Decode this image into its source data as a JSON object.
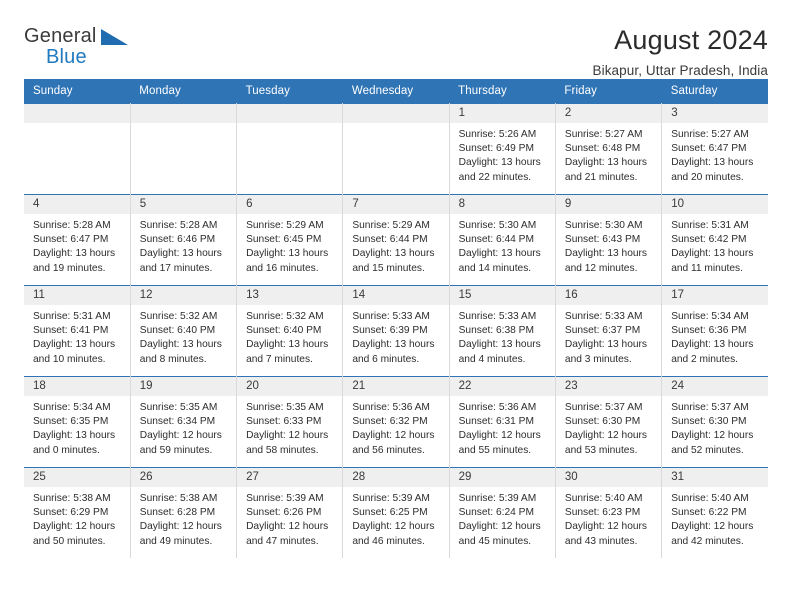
{
  "logo": {
    "word_top": "General",
    "word_bottom": "Blue",
    "accent_color": "#1f6cb0"
  },
  "header": {
    "title": "August 2024",
    "subtitle": "Bikapur, Uttar Pradesh, India"
  },
  "theme": {
    "header_blue": "#2f74b5",
    "daynum_band": "#efefef",
    "grid_line": "#d9d9d9"
  },
  "weekday_headers": [
    "Sunday",
    "Monday",
    "Tuesday",
    "Wednesday",
    "Thursday",
    "Friday",
    "Saturday"
  ],
  "weeks": [
    [
      {
        "day": "",
        "sunrise": "",
        "sunset": "",
        "daylight": "",
        "empty": true
      },
      {
        "day": "",
        "sunrise": "",
        "sunset": "",
        "daylight": "",
        "empty": true
      },
      {
        "day": "",
        "sunrise": "",
        "sunset": "",
        "daylight": "",
        "empty": true
      },
      {
        "day": "",
        "sunrise": "",
        "sunset": "",
        "daylight": "",
        "empty": true
      },
      {
        "day": "1",
        "sunrise": "Sunrise: 5:26 AM",
        "sunset": "Sunset: 6:49 PM",
        "daylight": "Daylight: 13 hours and 22 minutes."
      },
      {
        "day": "2",
        "sunrise": "Sunrise: 5:27 AM",
        "sunset": "Sunset: 6:48 PM",
        "daylight": "Daylight: 13 hours and 21 minutes."
      },
      {
        "day": "3",
        "sunrise": "Sunrise: 5:27 AM",
        "sunset": "Sunset: 6:47 PM",
        "daylight": "Daylight: 13 hours and 20 minutes."
      }
    ],
    [
      {
        "day": "4",
        "sunrise": "Sunrise: 5:28 AM",
        "sunset": "Sunset: 6:47 PM",
        "daylight": "Daylight: 13 hours and 19 minutes."
      },
      {
        "day": "5",
        "sunrise": "Sunrise: 5:28 AM",
        "sunset": "Sunset: 6:46 PM",
        "daylight": "Daylight: 13 hours and 17 minutes."
      },
      {
        "day": "6",
        "sunrise": "Sunrise: 5:29 AM",
        "sunset": "Sunset: 6:45 PM",
        "daylight": "Daylight: 13 hours and 16 minutes."
      },
      {
        "day": "7",
        "sunrise": "Sunrise: 5:29 AM",
        "sunset": "Sunset: 6:44 PM",
        "daylight": "Daylight: 13 hours and 15 minutes."
      },
      {
        "day": "8",
        "sunrise": "Sunrise: 5:30 AM",
        "sunset": "Sunset: 6:44 PM",
        "daylight": "Daylight: 13 hours and 14 minutes."
      },
      {
        "day": "9",
        "sunrise": "Sunrise: 5:30 AM",
        "sunset": "Sunset: 6:43 PM",
        "daylight": "Daylight: 13 hours and 12 minutes."
      },
      {
        "day": "10",
        "sunrise": "Sunrise: 5:31 AM",
        "sunset": "Sunset: 6:42 PM",
        "daylight": "Daylight: 13 hours and 11 minutes."
      }
    ],
    [
      {
        "day": "11",
        "sunrise": "Sunrise: 5:31 AM",
        "sunset": "Sunset: 6:41 PM",
        "daylight": "Daylight: 13 hours and 10 minutes."
      },
      {
        "day": "12",
        "sunrise": "Sunrise: 5:32 AM",
        "sunset": "Sunset: 6:40 PM",
        "daylight": "Daylight: 13 hours and 8 minutes."
      },
      {
        "day": "13",
        "sunrise": "Sunrise: 5:32 AM",
        "sunset": "Sunset: 6:40 PM",
        "daylight": "Daylight: 13 hours and 7 minutes."
      },
      {
        "day": "14",
        "sunrise": "Sunrise: 5:33 AM",
        "sunset": "Sunset: 6:39 PM",
        "daylight": "Daylight: 13 hours and 6 minutes."
      },
      {
        "day": "15",
        "sunrise": "Sunrise: 5:33 AM",
        "sunset": "Sunset: 6:38 PM",
        "daylight": "Daylight: 13 hours and 4 minutes."
      },
      {
        "day": "16",
        "sunrise": "Sunrise: 5:33 AM",
        "sunset": "Sunset: 6:37 PM",
        "daylight": "Daylight: 13 hours and 3 minutes."
      },
      {
        "day": "17",
        "sunrise": "Sunrise: 5:34 AM",
        "sunset": "Sunset: 6:36 PM",
        "daylight": "Daylight: 13 hours and 2 minutes."
      }
    ],
    [
      {
        "day": "18",
        "sunrise": "Sunrise: 5:34 AM",
        "sunset": "Sunset: 6:35 PM",
        "daylight": "Daylight: 13 hours and 0 minutes."
      },
      {
        "day": "19",
        "sunrise": "Sunrise: 5:35 AM",
        "sunset": "Sunset: 6:34 PM",
        "daylight": "Daylight: 12 hours and 59 minutes."
      },
      {
        "day": "20",
        "sunrise": "Sunrise: 5:35 AM",
        "sunset": "Sunset: 6:33 PM",
        "daylight": "Daylight: 12 hours and 58 minutes."
      },
      {
        "day": "21",
        "sunrise": "Sunrise: 5:36 AM",
        "sunset": "Sunset: 6:32 PM",
        "daylight": "Daylight: 12 hours and 56 minutes."
      },
      {
        "day": "22",
        "sunrise": "Sunrise: 5:36 AM",
        "sunset": "Sunset: 6:31 PM",
        "daylight": "Daylight: 12 hours and 55 minutes."
      },
      {
        "day": "23",
        "sunrise": "Sunrise: 5:37 AM",
        "sunset": "Sunset: 6:30 PM",
        "daylight": "Daylight: 12 hours and 53 minutes."
      },
      {
        "day": "24",
        "sunrise": "Sunrise: 5:37 AM",
        "sunset": "Sunset: 6:30 PM",
        "daylight": "Daylight: 12 hours and 52 minutes."
      }
    ],
    [
      {
        "day": "25",
        "sunrise": "Sunrise: 5:38 AM",
        "sunset": "Sunset: 6:29 PM",
        "daylight": "Daylight: 12 hours and 50 minutes."
      },
      {
        "day": "26",
        "sunrise": "Sunrise: 5:38 AM",
        "sunset": "Sunset: 6:28 PM",
        "daylight": "Daylight: 12 hours and 49 minutes."
      },
      {
        "day": "27",
        "sunrise": "Sunrise: 5:39 AM",
        "sunset": "Sunset: 6:26 PM",
        "daylight": "Daylight: 12 hours and 47 minutes."
      },
      {
        "day": "28",
        "sunrise": "Sunrise: 5:39 AM",
        "sunset": "Sunset: 6:25 PM",
        "daylight": "Daylight: 12 hours and 46 minutes."
      },
      {
        "day": "29",
        "sunrise": "Sunrise: 5:39 AM",
        "sunset": "Sunset: 6:24 PM",
        "daylight": "Daylight: 12 hours and 45 minutes."
      },
      {
        "day": "30",
        "sunrise": "Sunrise: 5:40 AM",
        "sunset": "Sunset: 6:23 PM",
        "daylight": "Daylight: 12 hours and 43 minutes."
      },
      {
        "day": "31",
        "sunrise": "Sunrise: 5:40 AM",
        "sunset": "Sunset: 6:22 PM",
        "daylight": "Daylight: 12 hours and 42 minutes."
      }
    ]
  ]
}
